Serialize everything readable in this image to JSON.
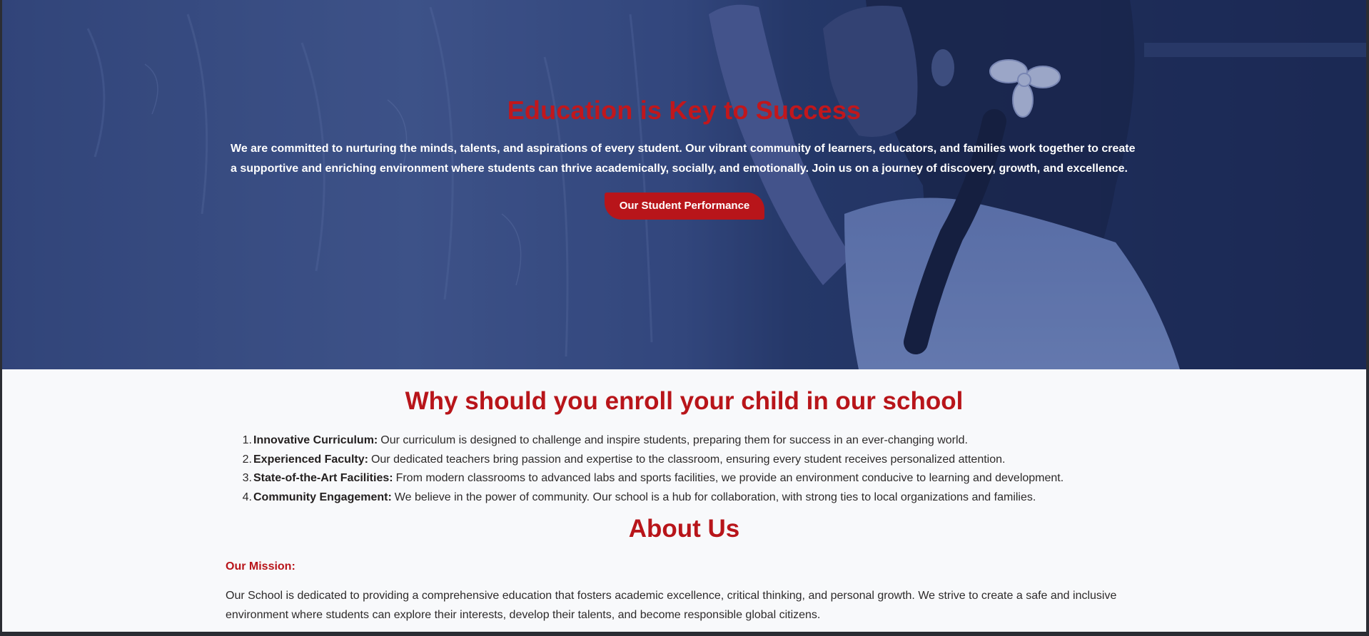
{
  "hero": {
    "title": "Education is Key to Success",
    "description": "We are committed to nurturing the minds, talents, and aspirations of every student. Our vibrant community of learners, educators, and families work together to create a supportive and enriching environment where students can thrive academically, socially, and emotionally. Join us on a journey of discovery, growth, and excellence.",
    "button_label": "Our Student Performance"
  },
  "why": {
    "title": "Why should you enroll your child in our school",
    "items": [
      {
        "number": "1.",
        "label": "Innovative Curriculum:",
        "text": "Our curriculum is designed to challenge and inspire students, preparing them for success in an ever-changing world."
      },
      {
        "number": "2.",
        "label": "Experienced Faculty:",
        "text": "Our dedicated teachers bring passion and expertise to the classroom, ensuring every student receives personalized attention."
      },
      {
        "number": "3.",
        "label": "State-of-the-Art Facilities:",
        "text": "From modern classrooms to advanced labs and sports facilities, we provide an environment conducive to learning and development."
      },
      {
        "number": "4.",
        "label": "Community Engagement:",
        "text": "We believe in the power of community. Our school is a hub for collaboration, with strong ties to local organizations and families."
      }
    ]
  },
  "about": {
    "title": "About Us",
    "mission_label": "Our Mission:",
    "mission_text": "Our School is dedicated to providing a comprehensive education that fosters academic excellence, critical thinking, and personal growth. We strive to create a safe and inclusive environment where students can explore their interests, develop their talents, and become responsible global citizens."
  },
  "colors": {
    "accent": "#b8151a",
    "hero_overlay": "#2c3f70",
    "text": "#2d2a2a",
    "background": "#f8f9fb"
  }
}
